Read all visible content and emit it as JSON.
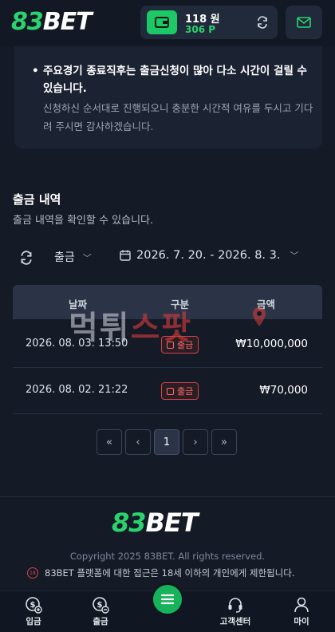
{
  "header": {
    "logo_num": "83",
    "logo_text": "BET",
    "wallet_amount": "118 원",
    "wallet_points": "306 P"
  },
  "notice": {
    "bullet": "•",
    "line1": "주요경기 종료직후는 출금신청이 많아 다소 시간이 걸릴 수 있습니다.",
    "line2": "신청하신 순서대로 진행되오니 충분한 시간적 여유를 두시고 기다려 주시면 감사하겠습니다."
  },
  "history": {
    "title": "출금 내역",
    "subtitle": "출금 내역을 확인할 수 있습니다.",
    "type_filter": "출금",
    "date_range": "2026. 7. 20. - 2026. 8. 3.",
    "columns": [
      "날짜",
      "구분",
      "금액"
    ],
    "rows": [
      {
        "date": "2026. 08. 03. 13:50",
        "type": "출금",
        "amount": "₩10,000,000"
      },
      {
        "date": "2026. 08. 02. 21:22",
        "type": "출금",
        "amount": "₩70,000"
      }
    ]
  },
  "watermark": {
    "part1": "먹튀",
    "part2": "스팟"
  },
  "pagination": {
    "first": "«",
    "prev": "‹",
    "current": "1",
    "next": "›",
    "last": "»"
  },
  "footer": {
    "logo_num": "83",
    "logo_text": "BET",
    "copyright": "Copyright 2025 83BET. All rights reserved.",
    "age_icon": "18",
    "age_notice": "83BET 플랫폼에 대한 접근은 18세 이하의 개인에게 제한됩니다."
  },
  "bottom_nav": {
    "deposit": "입금",
    "withdraw": "출금",
    "support": "고객센터",
    "my": "마이"
  },
  "colors": {
    "accent": "#2bd36f",
    "background": "#141a26",
    "danger": "#d2434a"
  }
}
